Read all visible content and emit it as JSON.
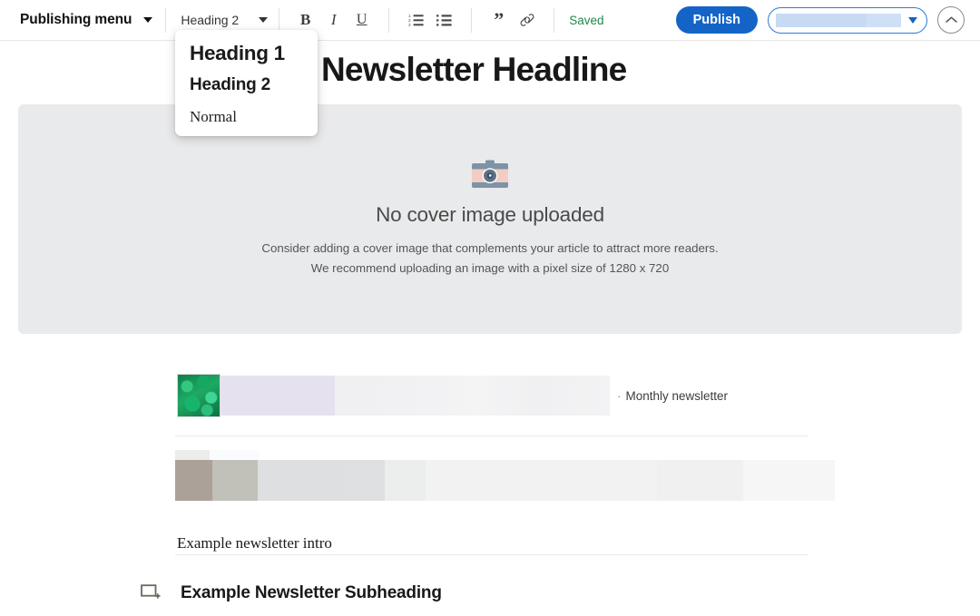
{
  "toolbar": {
    "publishing_menu_label": "Publishing menu",
    "publishing_menu_caret": "chevron-down-icon",
    "style_selected": "Heading 2",
    "format_buttons": [
      {
        "name": "bold",
        "glyph": "B"
      },
      {
        "name": "italic",
        "glyph": "I"
      },
      {
        "name": "underline",
        "glyph": "U"
      }
    ],
    "list_buttons": [
      {
        "name": "ordered-list",
        "icon": "ordered-list-icon"
      },
      {
        "name": "bullet-list",
        "icon": "bullet-list-icon"
      }
    ],
    "quote_glyph": "”",
    "link_icon": "link-icon",
    "save_status": "Saved",
    "save_status_color": "#1f8a4c",
    "publish_label": "Publish",
    "publish_color": "#1464c8",
    "audience_select_placeholder": "",
    "audience_select_border_color": "#2a7ddb",
    "collapse_icon": "chevron-up-icon"
  },
  "style_menu": {
    "items": [
      {
        "label": "Heading 1",
        "style": "h1"
      },
      {
        "label": "Heading 2",
        "style": "h2"
      },
      {
        "label": "Normal",
        "style": "normal"
      }
    ]
  },
  "document": {
    "headline": "Newsletter Headline",
    "cover": {
      "icon": "camera-icon",
      "title": "No cover image uploaded",
      "line1": "Consider adding a cover image that complements your article to attract more readers.",
      "line2": "We recommend uploading an image with a pixel size of 1280 x 720",
      "background_color": "#e9eaeb"
    },
    "blocks": [
      {
        "type": "image-text-row",
        "thumbnail": "green-leaves-photo",
        "caption_bullet": "·",
        "caption": "Monthly newsletter"
      },
      {
        "type": "placeholder-row"
      },
      {
        "type": "paragraph",
        "text": "Example newsletter intro"
      },
      {
        "type": "heading",
        "add_block_icon": "add-block-icon",
        "text": "Example Newsletter Subheading"
      }
    ]
  }
}
